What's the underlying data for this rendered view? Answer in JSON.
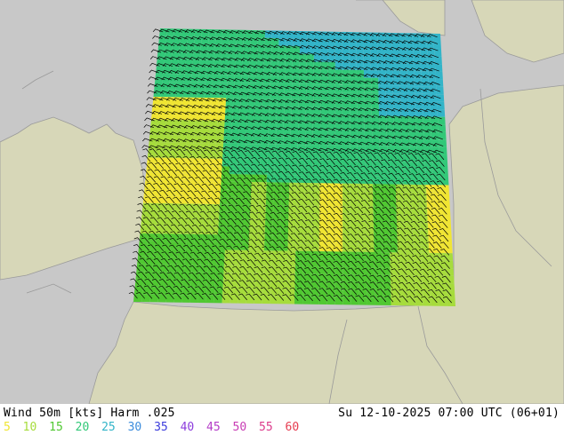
{
  "map": {
    "background_color": "#c8c8c8",
    "land_color": "#d7d7b8",
    "sea_color": "#c8c8c8",
    "border_color": "#9a9a9a",
    "barb_color": "#000000"
  },
  "footer": {
    "title": "Wind 50m [kts] Harm .025",
    "datetime": "Su 12-10-2025 07:00 UTC (06+01)"
  },
  "legend": {
    "items": [
      {
        "label": "5",
        "color": "#f0e532"
      },
      {
        "label": "10",
        "color": "#a6dc3c"
      },
      {
        "label": "15",
        "color": "#50c832"
      },
      {
        "label": "20",
        "color": "#32c878"
      },
      {
        "label": "25",
        "color": "#32b4c8"
      },
      {
        "label": "30",
        "color": "#3c8cdc"
      },
      {
        "label": "35",
        "color": "#3c3cdc"
      },
      {
        "label": "40",
        "color": "#8c3cdc"
      },
      {
        "label": "45",
        "color": "#b43cc8"
      },
      {
        "label": "50",
        "color": "#c83cb4"
      },
      {
        "label": "55",
        "color": "#dc3c8c"
      },
      {
        "label": "60",
        "color": "#e63c50"
      }
    ]
  }
}
